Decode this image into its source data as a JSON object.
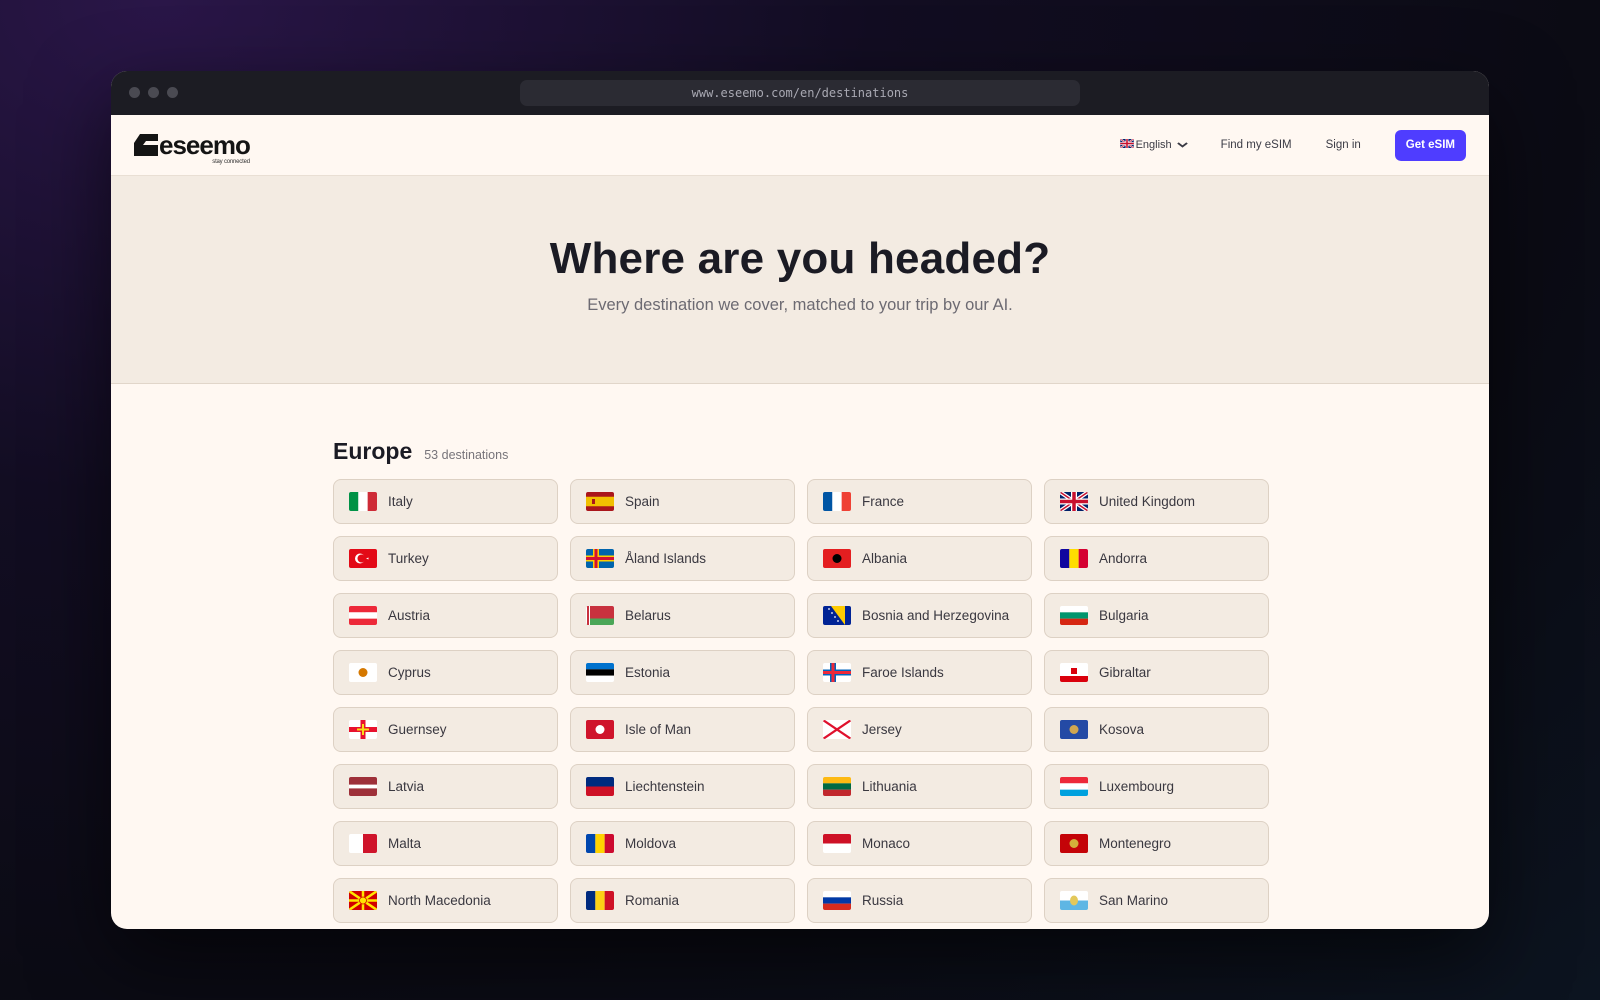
{
  "browser": {
    "url": "www.eseemo.com/en/destinations"
  },
  "header": {
    "logo_text": "eseemo",
    "logo_tagline": "stay connected",
    "language": "English",
    "find_esim": "Find my eSIM",
    "sign_in": "Sign in",
    "cta": "Get eSIM"
  },
  "hero": {
    "title": "Where are you headed?",
    "subtitle": "Every destination we cover, matched to your trip by our AI."
  },
  "region": {
    "title": "Europe",
    "count": "53 destinations",
    "destinations": [
      {
        "name": "Italy",
        "flag": "italy-flag",
        "colors": [
          "#009246",
          "#ffffff",
          "#ce2b37"
        ],
        "kind": "v3"
      },
      {
        "name": "Spain",
        "flag": "spain-flag",
        "colors": [
          "#aa151b",
          "#f1bf00",
          "#aa151b"
        ],
        "kind": "h3s"
      },
      {
        "name": "France",
        "flag": "france-flag",
        "colors": [
          "#0055a4",
          "#ffffff",
          "#ef4135"
        ],
        "kind": "v3"
      },
      {
        "name": "United Kingdom",
        "flag": "uk-flag",
        "colors": [
          "#012169",
          "#ffffff",
          "#c8102e"
        ],
        "kind": "uk"
      },
      {
        "name": "Turkey",
        "flag": "turkey-flag",
        "colors": [
          "#e30a17",
          "#ffffff"
        ],
        "kind": "crescent"
      },
      {
        "name": "Åland Islands",
        "flag": "aland-flag",
        "colors": [
          "#0064ad",
          "#ffce00",
          "#d21034"
        ],
        "kind": "nordic2"
      },
      {
        "name": "Albania",
        "flag": "albania-flag",
        "colors": [
          "#e41e20",
          "#000000"
        ],
        "kind": "emblem"
      },
      {
        "name": "Andorra",
        "flag": "andorra-flag",
        "colors": [
          "#10069f",
          "#fedd00",
          "#d50032"
        ],
        "kind": "v3"
      },
      {
        "name": "Austria",
        "flag": "austria-flag",
        "colors": [
          "#ed2939",
          "#ffffff",
          "#ed2939"
        ],
        "kind": "h3"
      },
      {
        "name": "Belarus",
        "flag": "belarus-flag",
        "colors": [
          "#c8313e",
          "#4aa657",
          "#ffffff"
        ],
        "kind": "belarus"
      },
      {
        "name": "Bosnia and Herzegovina",
        "flag": "bosnia-flag",
        "colors": [
          "#002395",
          "#fecb00",
          "#ffffff"
        ],
        "kind": "bosnia"
      },
      {
        "name": "Bulgaria",
        "flag": "bulgaria-flag",
        "colors": [
          "#ffffff",
          "#00966e",
          "#d62612"
        ],
        "kind": "h3"
      },
      {
        "name": "Cyprus",
        "flag": "cyprus-flag",
        "colors": [
          "#ffffff",
          "#d57800"
        ],
        "kind": "emblem"
      },
      {
        "name": "Estonia",
        "flag": "estonia-flag",
        "colors": [
          "#0072ce",
          "#000000",
          "#ffffff"
        ],
        "kind": "h3"
      },
      {
        "name": "Faroe Islands",
        "flag": "faroe-flag",
        "colors": [
          "#ffffff",
          "#0065bd",
          "#ed2939"
        ],
        "kind": "nordic2"
      },
      {
        "name": "Gibraltar",
        "flag": "gibraltar-flag",
        "colors": [
          "#ffffff",
          "#da000c"
        ],
        "kind": "h2big"
      },
      {
        "name": "Guernsey",
        "flag": "guernsey-flag",
        "colors": [
          "#ffffff",
          "#e8112d",
          "#f9dd16"
        ],
        "kind": "cross"
      },
      {
        "name": "Isle of Man",
        "flag": "isle-of-man-flag",
        "colors": [
          "#cf142b",
          "#ffffff"
        ],
        "kind": "emblem"
      },
      {
        "name": "Jersey",
        "flag": "jersey-flag",
        "colors": [
          "#ffffff",
          "#df112d"
        ],
        "kind": "saltire"
      },
      {
        "name": "Kosova",
        "flag": "kosova-flag",
        "colors": [
          "#244aa5",
          "#d0a650"
        ],
        "kind": "emblem"
      },
      {
        "name": "Latvia",
        "flag": "latvia-flag",
        "colors": [
          "#9e3039",
          "#ffffff",
          "#9e3039"
        ],
        "kind": "h3thin"
      },
      {
        "name": "Liechtenstein",
        "flag": "liechtenstein-flag",
        "colors": [
          "#002b7f",
          "#ce1126"
        ],
        "kind": "h2"
      },
      {
        "name": "Lithuania",
        "flag": "lithuania-flag",
        "colors": [
          "#fdb913",
          "#006a44",
          "#c1272d"
        ],
        "kind": "h3"
      },
      {
        "name": "Luxembourg",
        "flag": "luxembourg-flag",
        "colors": [
          "#ed2939",
          "#ffffff",
          "#00a1de"
        ],
        "kind": "h3"
      },
      {
        "name": "Malta",
        "flag": "malta-flag",
        "colors": [
          "#ffffff",
          "#cf142b"
        ],
        "kind": "v2"
      },
      {
        "name": "Moldova",
        "flag": "moldova-flag",
        "colors": [
          "#0046ae",
          "#ffd200",
          "#cc092f"
        ],
        "kind": "v3"
      },
      {
        "name": "Monaco",
        "flag": "monaco-flag",
        "colors": [
          "#ce1126",
          "#ffffff"
        ],
        "kind": "h2"
      },
      {
        "name": "Montenegro",
        "flag": "montenegro-flag",
        "colors": [
          "#c40308",
          "#d4af3a"
        ],
        "kind": "emblem"
      },
      {
        "name": "North Macedonia",
        "flag": "north-macedonia-flag",
        "colors": [
          "#d20000",
          "#ffe600"
        ],
        "kind": "sun"
      },
      {
        "name": "Romania",
        "flag": "romania-flag",
        "colors": [
          "#002b7f",
          "#fcd116",
          "#ce1126"
        ],
        "kind": "v3"
      },
      {
        "name": "Russia",
        "flag": "russia-flag",
        "colors": [
          "#ffffff",
          "#0039a6",
          "#d52b1e"
        ],
        "kind": "h3"
      },
      {
        "name": "San Marino",
        "flag": "san-marino-flag",
        "colors": [
          "#ffffff",
          "#5eb6e4"
        ],
        "kind": "h2emblem"
      }
    ]
  },
  "colors": {
    "accent": "#4f3dff",
    "card_bg": "#f3ebe2",
    "page_bg": "#fff8f2"
  }
}
